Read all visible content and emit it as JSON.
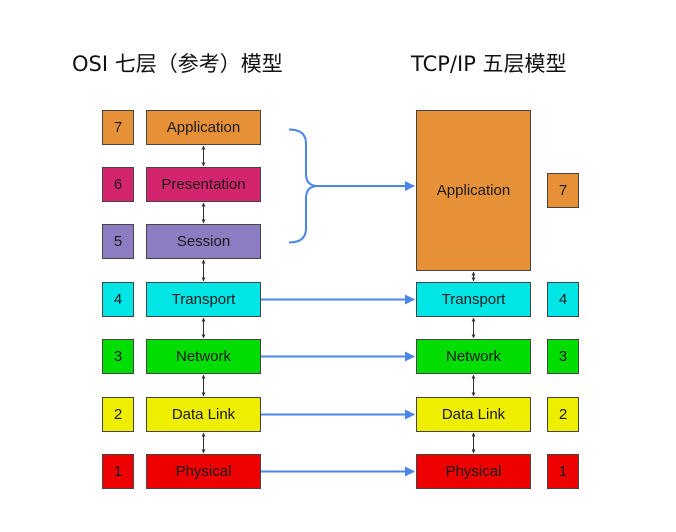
{
  "titles": {
    "osi": "OSI 七层（参考）模型",
    "tcpip": "TCP/IP 五层模型"
  },
  "osi_layers": [
    {
      "number": "7",
      "label": "Application",
      "color": "#E69138"
    },
    {
      "number": "6",
      "label": "Presentation",
      "color": "#D5246E"
    },
    {
      "number": "5",
      "label": "Session",
      "color": "#8E7CC3"
    },
    {
      "number": "4",
      "label": "Transport",
      "color": "#00E5E5"
    },
    {
      "number": "3",
      "label": "Network",
      "color": "#00DD00"
    },
    {
      "number": "2",
      "label": "Data Link",
      "color": "#EEEE00"
    },
    {
      "number": "1",
      "label": "Physical",
      "color": "#EE0000"
    }
  ],
  "tcpip_layers": [
    {
      "number": "7",
      "label": "Application",
      "color": "#E69138"
    },
    {
      "number": "4",
      "label": "Transport",
      "color": "#00E5E5"
    },
    {
      "number": "3",
      "label": "Network",
      "color": "#00DD00"
    },
    {
      "number": "2",
      "label": "Data Link",
      "color": "#EEEE00"
    },
    {
      "number": "1",
      "label": "Physical",
      "color": "#EE0000"
    }
  ],
  "colors": {
    "arrow": "#4A86E8",
    "link": "#333333"
  }
}
